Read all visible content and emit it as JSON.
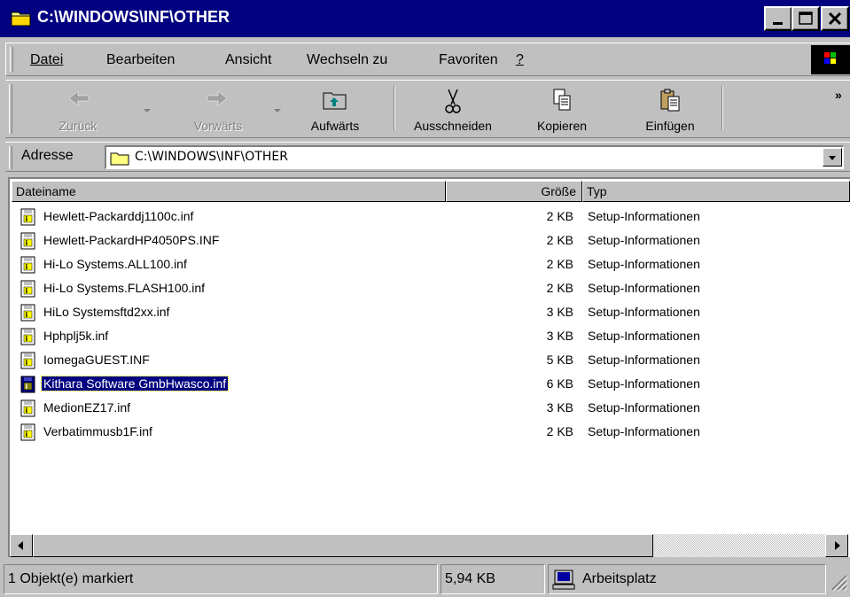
{
  "window": {
    "title": "C:\\WINDOWS\\INF\\OTHER"
  },
  "menu": {
    "datei": "Datei",
    "bearbeiten": "Bearbeiten",
    "ansicht": "Ansicht",
    "wechseln": "Wechseln zu",
    "favoriten": "Favoriten",
    "help": "?"
  },
  "toolbar": {
    "back": "Zurück",
    "forward": "Vorwärts",
    "up": "Aufwärts",
    "cut": "Ausschneiden",
    "copy": "Kopieren",
    "paste": "Einfügen",
    "more": "»"
  },
  "address": {
    "label": "Adresse",
    "value": "C:\\WINDOWS\\INF\\OTHER"
  },
  "columns": {
    "name": "Dateiname",
    "size": "Größe",
    "type": "Typ"
  },
  "files": [
    {
      "name": "Hewlett-Packarddj1100c.inf",
      "size": "2 KB",
      "type": "Setup-Informationen"
    },
    {
      "name": "Hewlett-PackardHP4050PS.INF",
      "size": "2 KB",
      "type": "Setup-Informationen"
    },
    {
      "name": "Hi-Lo Systems.ALL100.inf",
      "size": "2 KB",
      "type": "Setup-Informationen"
    },
    {
      "name": "Hi-Lo Systems.FLASH100.inf",
      "size": "2 KB",
      "type": "Setup-Informationen"
    },
    {
      "name": "HiLo Systemsftd2xx.inf",
      "size": "3 KB",
      "type": "Setup-Informationen"
    },
    {
      "name": "Hphplj5k.inf",
      "size": "3 KB",
      "type": "Setup-Informationen"
    },
    {
      "name": "IomegaGUEST.INF",
      "size": "5 KB",
      "type": "Setup-Informationen"
    },
    {
      "name": "Kithara Software GmbHwasco.inf",
      "size": "6 KB",
      "type": "Setup-Informationen"
    },
    {
      "name": "MedionEZ17.inf",
      "size": "3 KB",
      "type": "Setup-Informationen"
    },
    {
      "name": "Verbatimmusb1F.inf",
      "size": "2 KB",
      "type": "Setup-Informationen"
    }
  ],
  "status": {
    "selection": "1 Objekt(e) markiert",
    "size": "5,94 KB",
    "location": "Arbeitsplatz"
  }
}
